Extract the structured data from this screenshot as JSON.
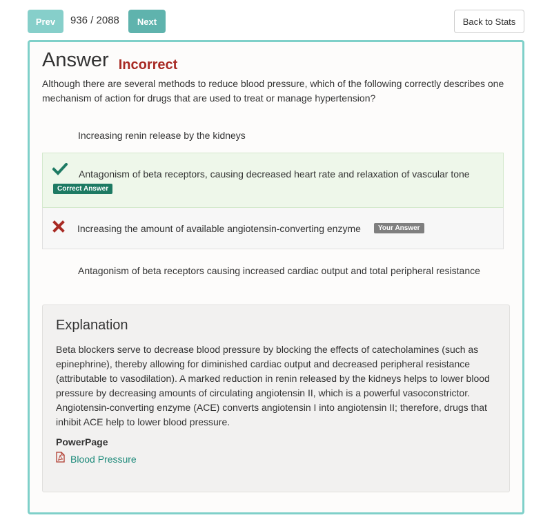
{
  "nav": {
    "prev_label": "Prev",
    "counter": "936 / 2088",
    "next_label": "Next",
    "back_label": "Back to Stats"
  },
  "answer": {
    "title": "Answer",
    "status": "Incorrect",
    "question": "Although there are several methods to reduce blood pressure, which of the following correctly describes one mechanism of action for drugs that are used to treat or manage hypertension?",
    "choices": [
      {
        "text": "Increasing renin release by the kidneys",
        "state": "none"
      },
      {
        "text": "Antagonism of beta receptors, causing decreased heart rate and relaxation of vascular tone",
        "state": "correct",
        "badge": "Correct Answer"
      },
      {
        "text": "Increasing the amount of available angiotensin-converting enzyme",
        "state": "your-answer",
        "badge": "Your Answer"
      },
      {
        "text": "Antagonism of beta receptors causing increased cardiac output and total peripheral resistance",
        "state": "none"
      }
    ]
  },
  "explanation": {
    "title": "Explanation",
    "body": "Beta blockers serve to decrease blood pressure by blocking the effects of catecholamines (such as epinephrine), thereby allowing for diminished cardiac output and decreased peripheral resistance (attributable to vasodilation). A marked reduction in renin released by the kidneys helps to lower blood pressure by decreasing amounts of circulating angiotensin II, which is a powerful vasoconstrictor. Angiotensin-converting enzyme (ACE) converts angiotensin I into angiotensin II; therefore, drugs that inhibit ACE help to lower blood pressure.",
    "powerpage_label": "PowerPage",
    "link_icon": "pdf-icon",
    "link_text": "Blood Pressure"
  },
  "colors": {
    "accent": "#7fd0c9",
    "correct": "#1d7a63",
    "incorrect": "#a82a24",
    "link": "#1d8a7a"
  }
}
